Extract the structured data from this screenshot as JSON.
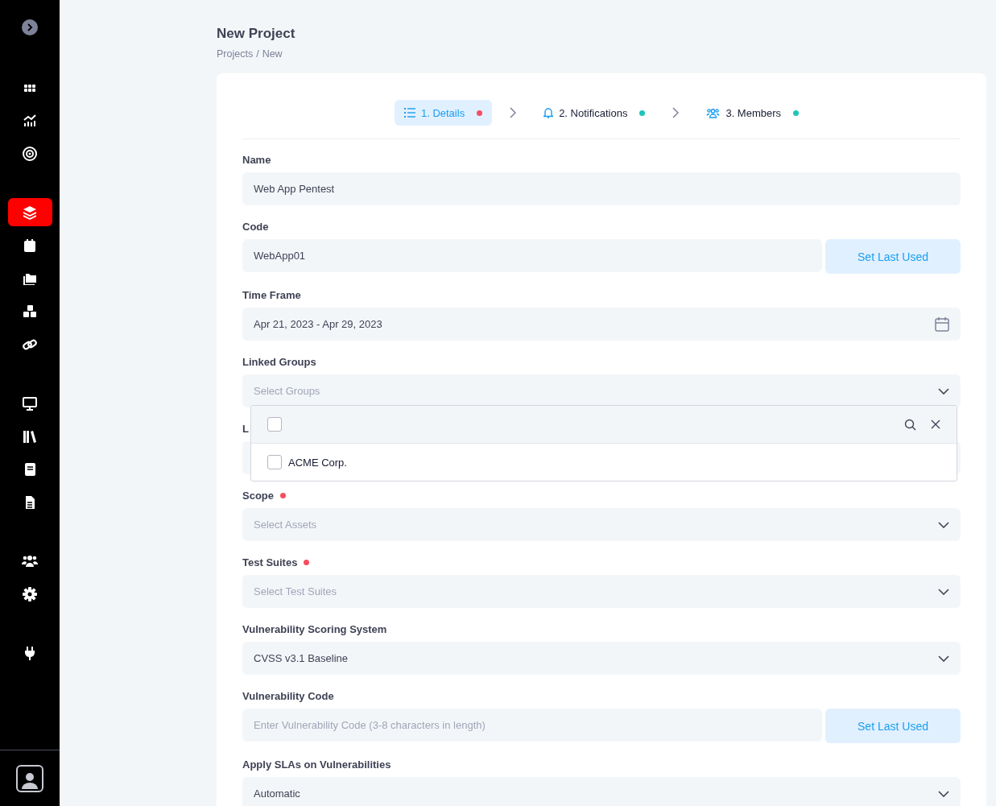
{
  "sidebar": {
    "groups": [
      [
        {
          "kind": "grid",
          "selected": false
        },
        {
          "kind": "chart",
          "selected": false
        },
        {
          "kind": "target",
          "selected": false
        }
      ],
      [
        {
          "kind": "layers",
          "selected": true
        },
        {
          "kind": "calendar",
          "selected": false
        },
        {
          "kind": "folders",
          "selected": false
        },
        {
          "kind": "cubes",
          "selected": false
        },
        {
          "kind": "link",
          "selected": false
        }
      ],
      [
        {
          "kind": "monitor",
          "selected": false
        },
        {
          "kind": "library",
          "selected": false
        },
        {
          "kind": "book",
          "selected": false
        },
        {
          "kind": "document",
          "selected": false
        }
      ],
      [
        {
          "kind": "users",
          "selected": false
        },
        {
          "kind": "gear",
          "selected": false
        }
      ],
      [
        {
          "kind": "plug",
          "selected": false
        }
      ]
    ]
  },
  "page": {
    "title": "New Project",
    "breadcrumb": [
      "Projects",
      "New"
    ],
    "breadcrumb_separator": "/"
  },
  "steps": [
    {
      "kind": "list",
      "label": "1. Details",
      "selected": true,
      "color": "#f64e60"
    },
    {
      "kind": "bell",
      "label": "2. Notifications",
      "selected": false,
      "color": "#1bc5bd"
    },
    {
      "kind": "users",
      "label": "3. Members",
      "selected": false,
      "color": "#1bc5bd"
    }
  ],
  "fields": [
    {
      "kind": "text",
      "label": "Name",
      "required": false,
      "value": "Web App Pentest"
    },
    {
      "kind": "text-button",
      "label": "Code",
      "required": false,
      "value": "WebApp01",
      "button": "Set Last Used"
    },
    {
      "kind": "date",
      "label": "Time Frame",
      "required": false,
      "value": "Apr 21, 2023 - Apr 29, 2023"
    },
    {
      "kind": "select",
      "label": "Linked Groups",
      "required": false,
      "placeholder": "Select Groups",
      "dropdown": {
        "select_all_checked": false,
        "options": [
          {
            "label": "ACME Corp.",
            "checked": false
          }
        ]
      }
    },
    {
      "kind": "covered",
      "label": "L"
    },
    {
      "kind": "select",
      "label": "Scope",
      "required": true,
      "placeholder": "Select Assets"
    },
    {
      "kind": "select",
      "label": "Test Suites",
      "required": true,
      "placeholder": "Select Test Suites"
    },
    {
      "kind": "select",
      "label": "Vulnerability Scoring System",
      "required": false,
      "value": "CVSS v3.1 Baseline"
    },
    {
      "kind": "text-button",
      "label": "Vulnerability Code",
      "required": false,
      "placeholder": "Enter Vulnerability Code (3-8 characters in length)",
      "button": "Set Last Used"
    },
    {
      "kind": "select",
      "label": "Apply SLAs on Vulnerabilities",
      "required": false,
      "value": "Automatic"
    }
  ]
}
